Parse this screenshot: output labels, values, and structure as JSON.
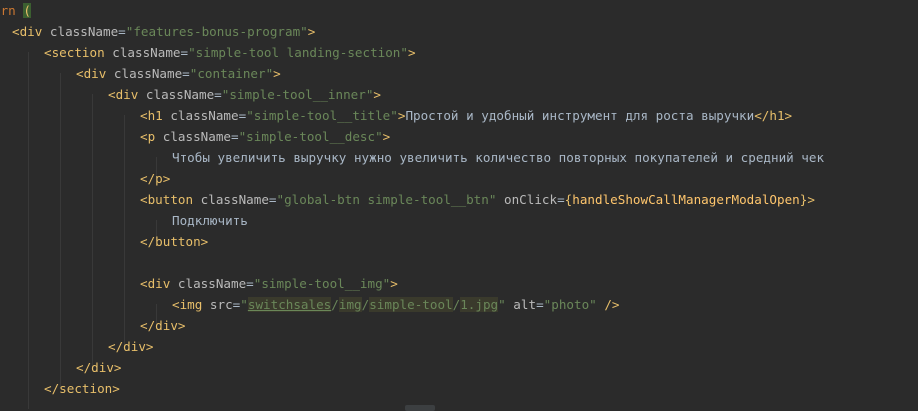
{
  "editor": {
    "lines": [
      {
        "tokens": [
          {
            "t": "urn ",
            "c": "t-kw"
          },
          {
            "t": "(",
            "c": "t-caret"
          }
        ]
      },
      {
        "tokens": [
          {
            "t": "<div ",
            "c": "t-tag"
          },
          {
            "t": "className",
            "c": "t-attr"
          },
          {
            "t": "=",
            "c": "t-text"
          },
          {
            "t": "\"features-bonus-program\"",
            "c": "t-str"
          },
          {
            "t": ">",
            "c": "t-tag"
          }
        ]
      },
      {
        "tokens": [
          {
            "t": "<section ",
            "c": "t-tag"
          },
          {
            "t": "className",
            "c": "t-attr"
          },
          {
            "t": "=",
            "c": "t-text"
          },
          {
            "t": "\"simple-tool landing-section\"",
            "c": "t-str"
          },
          {
            "t": ">",
            "c": "t-tag"
          }
        ]
      },
      {
        "tokens": [
          {
            "t": "<div ",
            "c": "t-tag"
          },
          {
            "t": "className",
            "c": "t-attr"
          },
          {
            "t": "=",
            "c": "t-text"
          },
          {
            "t": "\"container\"",
            "c": "t-str"
          },
          {
            "t": ">",
            "c": "t-tag"
          }
        ]
      },
      {
        "tokens": [
          {
            "t": "<div ",
            "c": "t-tag"
          },
          {
            "t": "className",
            "c": "t-attr"
          },
          {
            "t": "=",
            "c": "t-text"
          },
          {
            "t": "\"simple-tool__inner\"",
            "c": "t-str"
          },
          {
            "t": ">",
            "c": "t-tag"
          }
        ]
      },
      {
        "tokens": [
          {
            "t": "<h1 ",
            "c": "t-tag"
          },
          {
            "t": "className",
            "c": "t-attr"
          },
          {
            "t": "=",
            "c": "t-text"
          },
          {
            "t": "\"simple-tool__title\"",
            "c": "t-str"
          },
          {
            "t": ">",
            "c": "t-tag"
          },
          {
            "t": "Простой и удобный инструмент для роста выручки",
            "c": "t-text"
          },
          {
            "t": "</h1>",
            "c": "t-tag"
          }
        ]
      },
      {
        "tokens": [
          {
            "t": "<p ",
            "c": "t-tag"
          },
          {
            "t": "className",
            "c": "t-attr"
          },
          {
            "t": "=",
            "c": "t-text"
          },
          {
            "t": "\"simple-tool__desc\"",
            "c": "t-str"
          },
          {
            "t": ">",
            "c": "t-tag"
          }
        ]
      },
      {
        "tokens": [
          {
            "t": "Чтобы увеличить выручку нужно увеличить количество повторных покупателей и средний чек",
            "c": "t-text"
          }
        ]
      },
      {
        "tokens": [
          {
            "t": "</p>",
            "c": "t-tag"
          }
        ]
      },
      {
        "tokens": [
          {
            "t": "<button ",
            "c": "t-tag"
          },
          {
            "t": "className",
            "c": "t-attr"
          },
          {
            "t": "=",
            "c": "t-text"
          },
          {
            "t": "\"global-btn simple-tool__btn\"",
            "c": "t-str"
          },
          {
            "t": " onClick",
            "c": "t-attr"
          },
          {
            "t": "=",
            "c": "t-text"
          },
          {
            "t": "{",
            "c": "t-brace"
          },
          {
            "t": "handleShowCallManagerModalOpen",
            "c": "t-ident"
          },
          {
            "t": "}",
            "c": "t-brace"
          },
          {
            "t": ">",
            "c": "t-tag"
          }
        ]
      },
      {
        "tokens": [
          {
            "t": "Подключить",
            "c": "t-text"
          }
        ]
      },
      {
        "tokens": [
          {
            "t": "</button>",
            "c": "t-tag"
          }
        ]
      },
      {
        "tokens": []
      },
      {
        "tokens": [
          {
            "t": "<div ",
            "c": "t-tag"
          },
          {
            "t": "className",
            "c": "t-attr"
          },
          {
            "t": "=",
            "c": "t-text"
          },
          {
            "t": "\"simple-tool__img\"",
            "c": "t-str"
          },
          {
            "t": ">",
            "c": "t-tag"
          }
        ]
      },
      {
        "tokens": [
          {
            "t": "<img ",
            "c": "t-tag"
          },
          {
            "t": "src",
            "c": "t-attr"
          },
          {
            "t": "=",
            "c": "t-text"
          },
          {
            "t": "\"",
            "c": "t-str"
          },
          {
            "t": "switchsales",
            "c": "t-path-u"
          },
          {
            "t": "/",
            "c": "t-str"
          },
          {
            "t": "img",
            "c": "t-path"
          },
          {
            "t": "/",
            "c": "t-str"
          },
          {
            "t": "simple-tool",
            "c": "t-path"
          },
          {
            "t": "/",
            "c": "t-str"
          },
          {
            "t": "1.jpg",
            "c": "t-path"
          },
          {
            "t": "\"",
            "c": "t-str"
          },
          {
            "t": " alt",
            "c": "t-attr"
          },
          {
            "t": "=",
            "c": "t-text"
          },
          {
            "t": "\"photo\"",
            "c": "t-str"
          },
          {
            "t": " />",
            "c": "t-tag"
          }
        ]
      },
      {
        "tokens": [
          {
            "t": "</div>",
            "c": "t-tag"
          }
        ]
      },
      {
        "tokens": [
          {
            "t": "</div>",
            "c": "t-tag"
          }
        ]
      },
      {
        "tokens": [
          {
            "t": "</div>",
            "c": "t-tag"
          }
        ]
      },
      {
        "tokens": [
          {
            "t": "</section>",
            "c": "t-tag"
          }
        ]
      }
    ]
  },
  "colors": {
    "background": "#2b2b2b",
    "tag": "#e8bf6a",
    "attribute": "#bababa",
    "string": "#6a8759",
    "text": "#a9b7c6",
    "identifier": "#ffc66d",
    "indent_guide": "#393939"
  }
}
